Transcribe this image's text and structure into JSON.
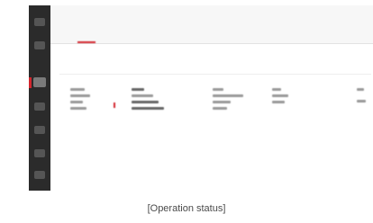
{
  "app": {
    "title_strong": "",
    "title_rest": ""
  },
  "tabs": [
    {
      "label": ""
    },
    {
      "label": ""
    }
  ],
  "section": {
    "label": ""
  },
  "columns": [
    {
      "header": ""
    },
    {
      "header": ""
    },
    {
      "header": ""
    },
    {
      "header": ""
    },
    {
      "header": ""
    }
  ],
  "sidebar": {
    "icons": [
      "menu-icon",
      "grid-icon",
      "dashboard-icon",
      "list-icon",
      "document-icon",
      "settings-icon",
      "info-icon"
    ]
  },
  "caption": "[Operation status]",
  "colors": {
    "sidebar": "#2b2b2b",
    "accent": "#d3262e",
    "topbar": "#f7f7f7"
  }
}
